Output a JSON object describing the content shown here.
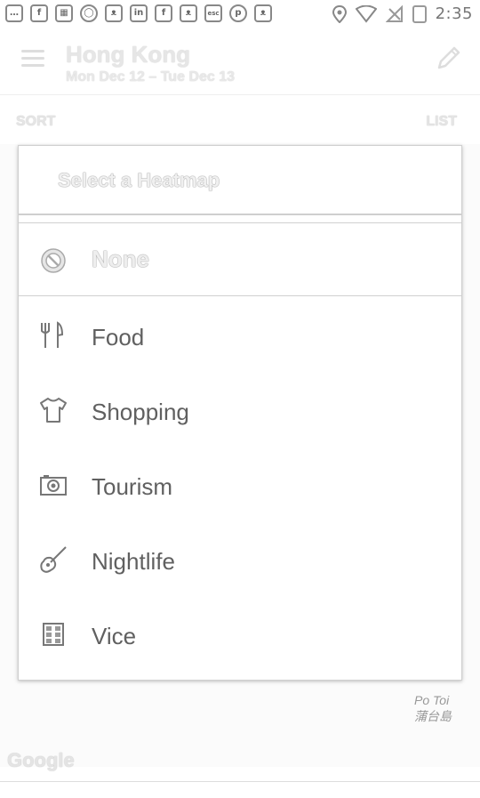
{
  "status_bar": {
    "time": "2:35",
    "left_icons": [
      "chat-bubble-icon",
      "facebook-icon",
      "news-icon",
      "whatsapp-icon",
      "cat-icon",
      "linkedin-icon",
      "facebook-icon",
      "cat-icon",
      "esc-icon",
      "pinterest-icon",
      "cat-icon"
    ],
    "left_icon_glyphs": [
      "…",
      "f",
      "▦",
      "◯",
      "ᴥ",
      "in",
      "f",
      "ᴥ",
      "esc",
      "p",
      "ᴥ"
    ]
  },
  "app_bar": {
    "title": "Hong Kong",
    "subtitle": "Mon Dec 12 – Tue Dec 13"
  },
  "toolbar": {
    "sort_label": "SORT",
    "list_label": "LIST"
  },
  "dialog": {
    "title": "Select a Heatmap",
    "none_label": "None",
    "options": [
      {
        "label": "Food",
        "icon": "fork-knife-icon"
      },
      {
        "label": "Shopping",
        "icon": "tshirt-icon"
      },
      {
        "label": "Tourism",
        "icon": "camera-icon"
      },
      {
        "label": "Nightlife",
        "icon": "guitar-icon"
      },
      {
        "label": "Vice",
        "icon": "building-icon"
      }
    ]
  },
  "map": {
    "place_label_line1": "Po Toi",
    "place_label_line2": "蒲台島",
    "attribution": "Google"
  }
}
